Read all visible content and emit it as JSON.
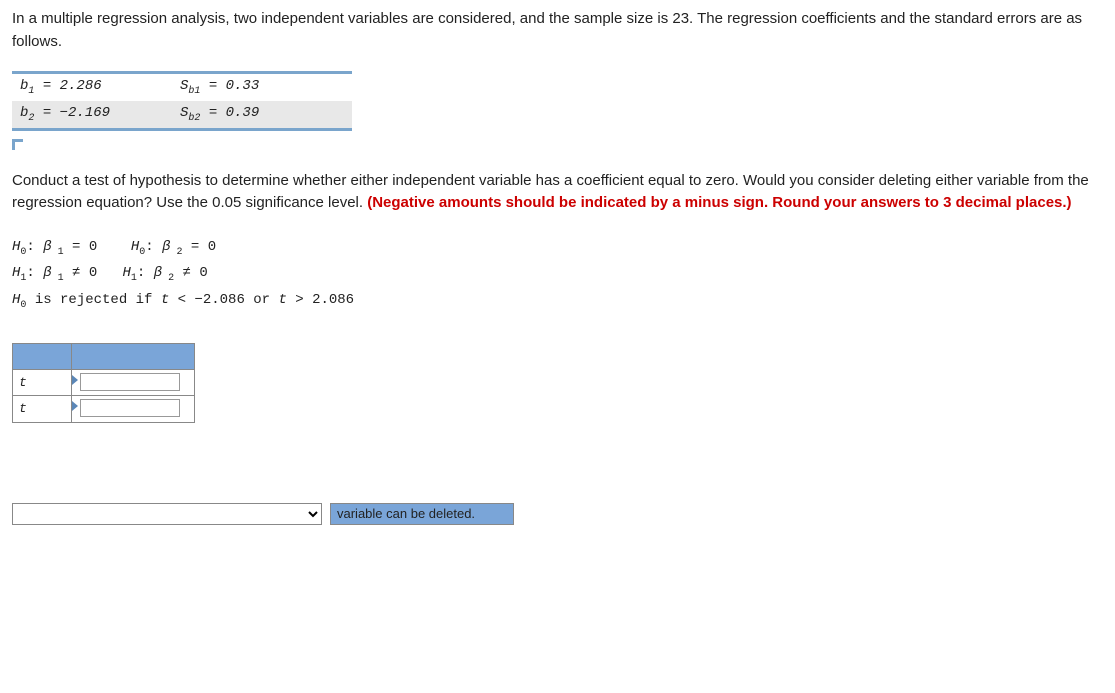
{
  "intro": "In a multiple regression analysis, two independent variables are considered, and the sample size is 23. The regression coefficients and the standard errors are as follows.",
  "coeff": {
    "b1_label": "b",
    "b1_sub": "1",
    "b1_eq": " = 2.286",
    "sb1_label": "S",
    "sb1_sub": "b1",
    "sb1_eq": " = 0.33",
    "b2_label": "b",
    "b2_sub": "2",
    "b2_eq": " = −2.169",
    "sb2_label": "S",
    "sb2_sub": "b2",
    "sb2_eq": " = 0.39"
  },
  "instr_plain": "Conduct a test of hypothesis to determine whether either independent variable has a coefficient equal to zero. Would you consider deleting either variable from the regression equation? Use the 0.05 significance level. ",
  "instr_red": "(Negative amounts should be indicated by a minus sign. Round your answers to 3 decimal places.)",
  "hyp": {
    "h0_1": "H",
    "h0_sub": "0",
    "colon": ": ",
    "beta": "β",
    "one": " 1",
    "two": " 2",
    "eq0": " = 0",
    "h1_1": "H",
    "h1_sub": "1",
    "neq0": " ≠ 0",
    "reject_line": "H0 is rejected if t < −2.086 or t > 2.086",
    "reject_prefix": " is rejected if ",
    "t": "t",
    "lt": " < −2.086 or ",
    "gt": " > 2.086"
  },
  "answer_rows": {
    "t1": "t",
    "t2": "t"
  },
  "bottom": {
    "placeholder": "",
    "label": "variable can be deleted."
  }
}
